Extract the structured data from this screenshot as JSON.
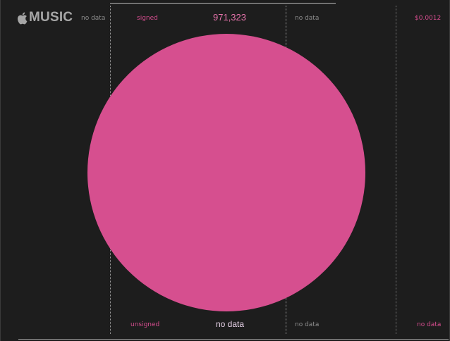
{
  "header": {
    "brand_text": "MUSIC",
    "brand_icon": "apple-icon",
    "left_status": "no data",
    "signed_label": "signed",
    "total_count": "971,323",
    "right_status": "no data",
    "price": "$0.0012"
  },
  "footer": {
    "unsigned_label": "unsigned",
    "center_status": "no data",
    "right_status": "no data",
    "far_right_status": "no data"
  },
  "colors": {
    "background": "#1d1d1d",
    "accent": "#d64d8f",
    "circle_fill": "#d64f8f",
    "muted_text": "#8e8e8e"
  }
}
